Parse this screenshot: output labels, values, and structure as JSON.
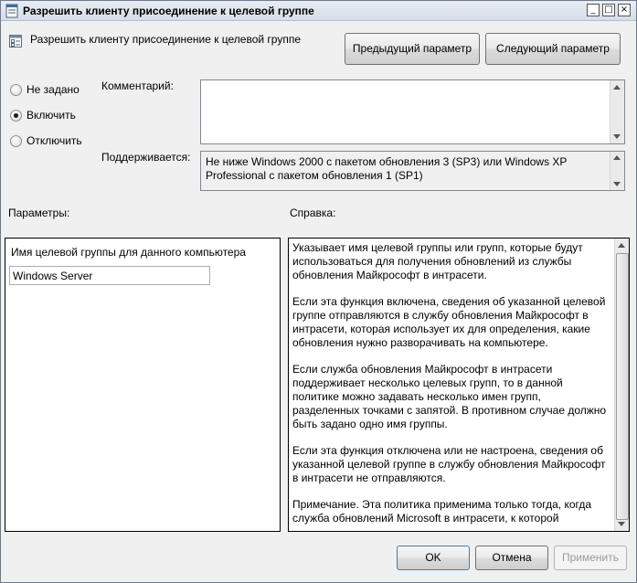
{
  "window": {
    "title": "Разрешить клиенту присоединение к целевой группе",
    "controls": {
      "minimize": "_",
      "maximize": "□",
      "close": "×"
    }
  },
  "header": {
    "policy_icon": "policy-setting-icon",
    "policy_name": "Разрешить клиенту присоединение к целевой группе",
    "prev_button": "Предыдущий параметр",
    "next_button": "Следующий параметр"
  },
  "state": {
    "options": [
      {
        "label": "Не задано",
        "selected": false
      },
      {
        "label": "Включить",
        "selected": true
      },
      {
        "label": "Отключить",
        "selected": false
      }
    ]
  },
  "comment": {
    "label": "Комментарий:",
    "value": ""
  },
  "supported": {
    "label": "Поддерживается:",
    "value": "Не ниже Windows 2000 с пакетом обновления 3 (SP3) или Windows XP Professional с пакетом обновления 1 (SP1)"
  },
  "parameters": {
    "label": "Параметры:",
    "field_label": "Имя целевой группы для данного компьютера",
    "field_value": "Windows Server"
  },
  "help": {
    "label": "Справка:",
    "paragraphs": [
      "Указывает имя целевой группы или групп, которые будут использоваться для получения обновлений из службы обновления Майкрософт в интрасети.",
      "Если эта функция включена, сведения об указанной целевой группе отправляются в службу обновления Майкрософт в интрасети, которая использует их для определения, какие обновления нужно разворачивать на компьютере.",
      "Если служба обновления Майкрософт в интрасети поддерживает несколько целевых групп, то в данной политике можно задавать несколько имен групп, разделенных точками с запятой. В противном случае должно быть задано одно имя группы.",
      "Если эта функция отключена или не настроена, сведения об указанной целевой группе в службу обновления Майкрософт в интрасети не отправляются.",
      "Примечание. Эта политика применима только тогда, когда служба обновлений Microsoft в интрасети, к которой"
    ]
  },
  "footer": {
    "ok": "OK",
    "cancel": "Отмена",
    "apply": "Применить"
  }
}
